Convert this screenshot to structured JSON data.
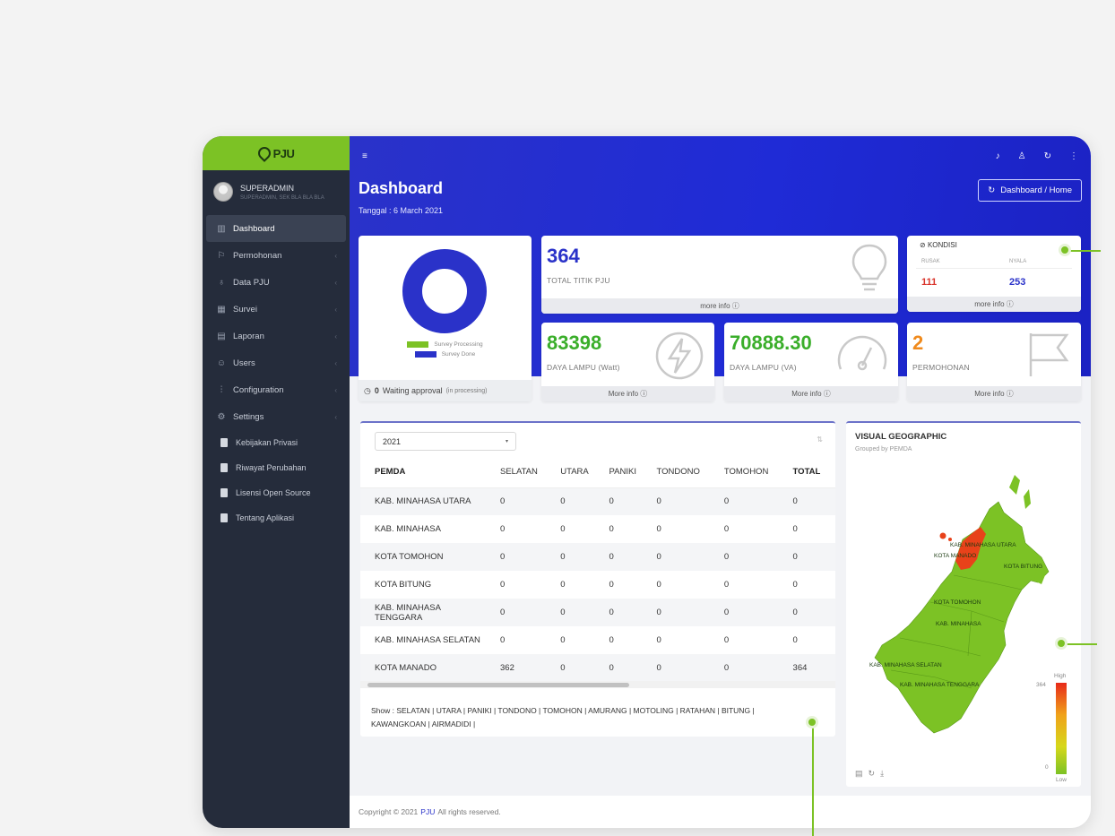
{
  "brand": {
    "logo_text": "PJU"
  },
  "user": {
    "name": "SUPERADMIN",
    "role": "SUPERADMIN, SEK BLA BLA BLA"
  },
  "sidebar": {
    "items": [
      {
        "label": "Dashboard",
        "icon": "bar-chart-icon"
      },
      {
        "label": "Permohonan",
        "icon": "flag-icon"
      },
      {
        "label": "Data PJU",
        "icon": "bulb-icon"
      },
      {
        "label": "Survei",
        "icon": "columns-icon"
      },
      {
        "label": "Laporan",
        "icon": "report-icon"
      },
      {
        "label": "Users",
        "icon": "users-icon"
      },
      {
        "label": "Configuration",
        "icon": "sliders-icon"
      },
      {
        "label": "Settings",
        "icon": "gear-icon"
      }
    ],
    "pages": [
      {
        "label": "Kebijakan Privasi"
      },
      {
        "label": "Riwayat Perubahan"
      },
      {
        "label": "Lisensi Open Source"
      },
      {
        "label": "Tentang Aplikasi"
      }
    ]
  },
  "header": {
    "title": "Dashboard",
    "date": "Tanggal : 6 March 2021",
    "breadcrumb": "Dashboard / Home"
  },
  "survey_card": {
    "legend_processing": "Survey Processing",
    "legend_done": "Survey Done",
    "waiting_count": "0",
    "waiting_label": "Waiting approval",
    "waiting_note": "(in processing)",
    "processing_fraction": 0,
    "colors": {
      "processing": "#7cc225",
      "done": "#2a32c9"
    }
  },
  "stats": {
    "titik": {
      "value": "364",
      "label": "TOTAL TITIK PJU",
      "more": "more info"
    },
    "kondisi": {
      "title": "KONDISI",
      "rusak_label": "RUSAK",
      "rusak_value": "111",
      "nyala_label": "NYALA",
      "nyala_value": "253",
      "more": "more info"
    },
    "watt": {
      "value": "83398",
      "label": "DAYA LAMPU (Watt)",
      "more": "More info"
    },
    "va": {
      "value": "70888.30",
      "label": "DAYA LAMPU (VA)",
      "more": "More info"
    },
    "permohonan": {
      "value": "2",
      "label": "PERMOHONAN",
      "more": "More info"
    }
  },
  "table": {
    "year": "2021",
    "columns": [
      "PEMDA",
      "SELATAN",
      "UTARA",
      "PANIKI",
      "TONDONO",
      "TOMOHON",
      "TOTAL"
    ],
    "rows": [
      [
        "KAB. MINAHASA UTARA",
        "0",
        "0",
        "0",
        "0",
        "0",
        "0"
      ],
      [
        "KAB. MINAHASA",
        "0",
        "0",
        "0",
        "0",
        "0",
        "0"
      ],
      [
        "KOTA TOMOHON",
        "0",
        "0",
        "0",
        "0",
        "0",
        "0"
      ],
      [
        "KOTA BITUNG",
        "0",
        "0",
        "0",
        "0",
        "0",
        "0"
      ],
      [
        "KAB. MINAHASA TENGGARA",
        "0",
        "0",
        "0",
        "0",
        "0",
        "0"
      ],
      [
        "KAB. MINAHASA SELATAN",
        "0",
        "0",
        "0",
        "0",
        "0",
        "0"
      ],
      [
        "KOTA MANADO",
        "362",
        "0",
        "0",
        "0",
        "0",
        "364"
      ]
    ],
    "show_text": "Show : SELATAN | UTARA | PANIKI | TONDONO | TOMOHON | AMURANG | MOTOLING | RATAHAN | BITUNG | KAWANGKOAN | AIRMADIDI |"
  },
  "map": {
    "title": "VISUAL GEOGRAPHIC",
    "subtitle": "Grouped by PEMDA",
    "labels": [
      "KAB. MINAHASA UTARA",
      "KOTA MANADO",
      "KOTA BITUNG",
      "KOTA TOMOHON",
      "KAB. MINAHASA",
      "KAB. MINAHASA SELATAN",
      "KAB. MINAHASA TENGGARA"
    ],
    "scale_high": "High",
    "scale_low": "Low",
    "scale_max": "364",
    "scale_min": "0",
    "colors": {
      "region": "#7cc225",
      "highlight": "#e8421a"
    }
  },
  "footer": {
    "prefix": "Copyright © 2021",
    "brand": "PJU",
    "suffix": "All rights reserved."
  }
}
